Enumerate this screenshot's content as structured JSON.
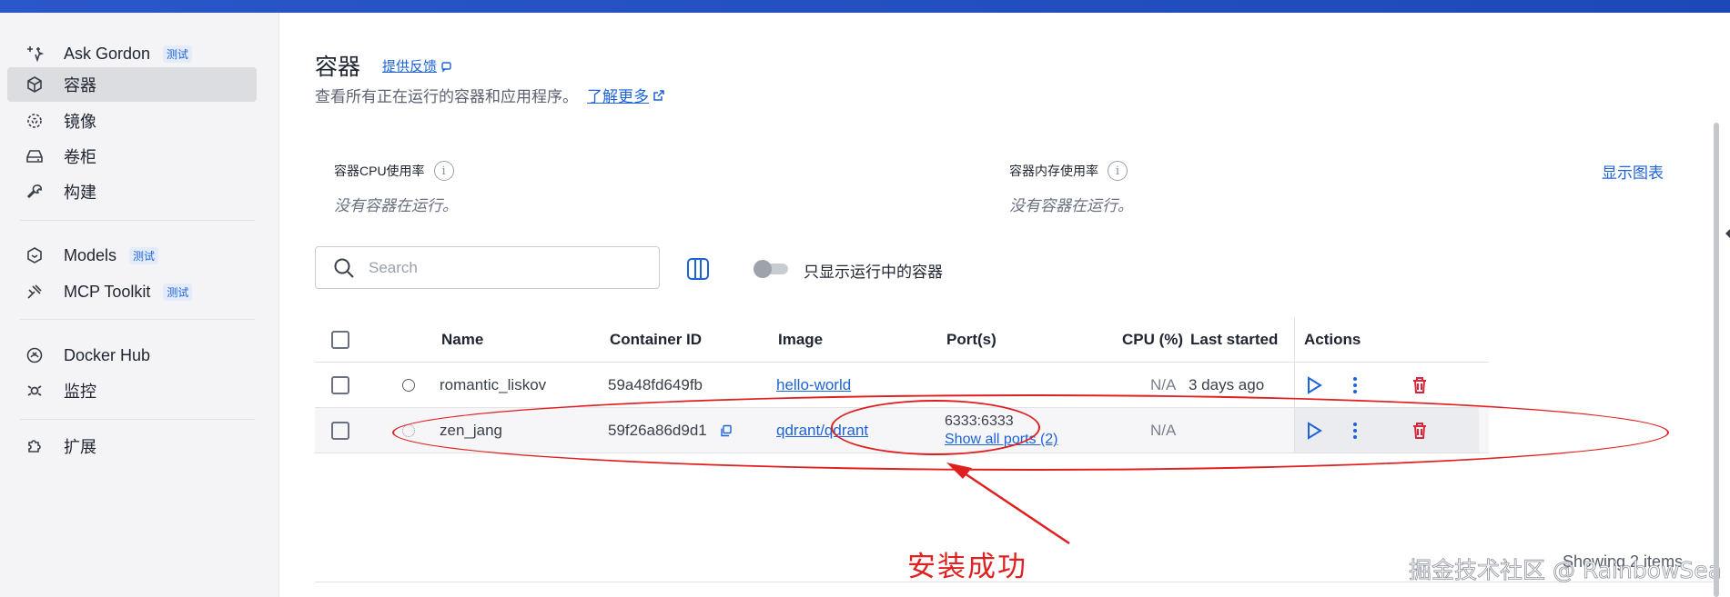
{
  "sidebar": {
    "items": [
      {
        "label": "Ask Gordon",
        "badge": "测试",
        "icon": "sparkle-icon"
      },
      {
        "label": "容器",
        "icon": "cube-icon",
        "active": true
      },
      {
        "label": "镜像",
        "icon": "image-layers-icon"
      },
      {
        "label": "卷柜",
        "icon": "volume-drive-icon"
      },
      {
        "label": "构建",
        "icon": "wrench-icon"
      },
      {
        "label": "Models",
        "badge": "测试",
        "icon": "model-cube-icon"
      },
      {
        "label": "MCP Toolkit",
        "badge": "测试",
        "icon": "toolkit-icon"
      },
      {
        "label": "Docker Hub",
        "icon": "hub-icon"
      },
      {
        "label": "监控",
        "icon": "monitor-icon"
      },
      {
        "label": "扩展",
        "icon": "puzzle-icon"
      }
    ]
  },
  "header": {
    "title": "容器",
    "feedback": "提供反馈",
    "subtitle": "查看所有正在运行的容器和应用程序。",
    "learn_more": "了解更多"
  },
  "stats": {
    "cpu_label": "容器CPU使用率",
    "cpu_empty": "没有容器在运行。",
    "mem_label": "容器内存使用率",
    "mem_empty": "没有容器在运行。",
    "show_chart": "显示图表"
  },
  "toolbar": {
    "search_placeholder": "Search",
    "toggle_label": "只显示运行中的容器",
    "toggle_on": false
  },
  "table": {
    "columns": [
      "Name",
      "Container ID",
      "Image",
      "Port(s)",
      "CPU (%)",
      "Last started",
      "Actions"
    ],
    "rows": [
      {
        "name": "romantic_liskov",
        "id": "59a48fd649fb",
        "image": "hello-world",
        "port": "",
        "port_link": "",
        "cpu": "N/A",
        "last_started": "3 days ago"
      },
      {
        "name": "zen_jang",
        "id": "59f26a86d9d1",
        "image": "qdrant/qdrant",
        "port": "6333:6333",
        "port_link": "Show all ports (2)",
        "cpu": "N/A",
        "last_started": ""
      }
    ]
  },
  "footer": {
    "showing": "Showing 2 items"
  },
  "annotation": {
    "text": "安装成功",
    "color": "#e02020"
  },
  "watermark": "掘金技术社区 @ RainbowSea",
  "colors": {
    "accent": "#1d63d8",
    "topbar": "#2a57c9",
    "danger": "#d6263b"
  }
}
